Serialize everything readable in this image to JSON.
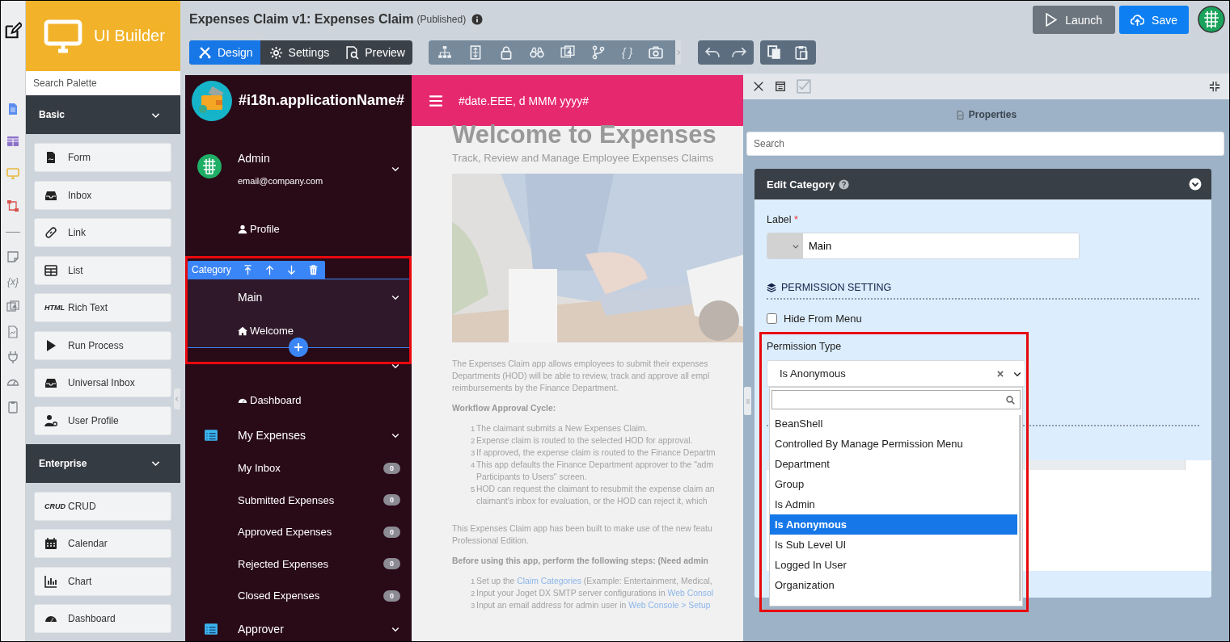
{
  "rail": {
    "glyph": "{x}"
  },
  "palette": {
    "title": "UI Builder",
    "search": {
      "placeholder": "Search Palette"
    },
    "sections": [
      {
        "title": "Basic",
        "items": [
          {
            "label": "Form"
          },
          {
            "label": "Inbox"
          },
          {
            "label": "Link"
          },
          {
            "label": "List"
          },
          {
            "label": "Rich Text",
            "glyph": "HTML"
          },
          {
            "label": "Run Process"
          },
          {
            "label": "Universal Inbox"
          },
          {
            "label": "User Profile"
          }
        ]
      },
      {
        "title": "Enterprise",
        "items": [
          {
            "label": "CRUD",
            "glyph": "CRUD"
          },
          {
            "label": "Calendar"
          },
          {
            "label": "Chart"
          },
          {
            "label": "Dashboard"
          }
        ]
      }
    ]
  },
  "header": {
    "title": "Expenses Claim v1: Expenses Claim",
    "status": "(Published)",
    "tabs": [
      {
        "label": "Design",
        "selected": true
      },
      {
        "label": "Settings",
        "selected": false
      },
      {
        "label": "Preview",
        "selected": false
      }
    ],
    "code_glyph": "{ }",
    "buttons": [
      {
        "label": "Launch",
        "kind": "secondary"
      },
      {
        "label": "Save",
        "kind": "primary"
      }
    ]
  },
  "app": {
    "name": "#i18n.applicationName#",
    "date": "#date.EEE, d MMM yyyy#",
    "user": {
      "name": "Admin",
      "email": "email@company.com"
    },
    "selection_label": "Category",
    "menu": [
      {
        "kind": "link",
        "label": "Profile"
      },
      {
        "kind": "category",
        "label": "Main",
        "selected": true,
        "children": [
          {
            "kind": "link",
            "label": "Welcome"
          }
        ]
      },
      {
        "kind": "category",
        "selected": false,
        "children": [
          {
            "kind": "link",
            "label": "Dashboard"
          }
        ]
      },
      {
        "kind": "category",
        "label": "My Expenses",
        "selected": false,
        "children": [
          {
            "kind": "inbox",
            "label": "My Inbox",
            "count": "0"
          },
          {
            "kind": "inbox",
            "label": "Submitted Expenses",
            "count": "0"
          },
          {
            "kind": "inbox",
            "label": "Approved Expenses",
            "count": "0"
          },
          {
            "kind": "inbox",
            "label": "Rejected Expenses",
            "count": "0"
          },
          {
            "kind": "inbox",
            "label": "Closed Expenses",
            "count": "0"
          }
        ]
      },
      {
        "kind": "category",
        "label": "Approver",
        "selected": false
      }
    ]
  },
  "content": {
    "title": "Welcome to Expenses",
    "subtitle": "Track, Review and Manage Employee Expenses Claims",
    "blocks": [
      {
        "kind": "paragraph",
        "lines": [
          "The Expenses Claim app allows employees to submit their expenses",
          "Departments (HOD) will be able to review, track and approve all empl",
          "reimbursements by the Finance Department."
        ]
      },
      {
        "kind": "heading",
        "text": "Workflow Approval Cycle:"
      },
      {
        "kind": "list",
        "items": [
          {
            "number": "1",
            "lines": [
              [
                {
                  "text": "The claimant submits a New Expenses Claim."
                }
              ]
            ]
          },
          {
            "number": "2",
            "lines": [
              [
                {
                  "text": "Expense claim is routed to the selected HOD for approval."
                }
              ]
            ]
          },
          {
            "number": "3",
            "lines": [
              [
                {
                  "text": "If approved, the expense claim is routed to the Finance Departm"
                }
              ]
            ]
          },
          {
            "number": "4",
            "lines": [
              [
                {
                  "text": "This app defaults the Finance Department approver to the \"adm"
                }
              ],
              [
                {
                  "text": "Participants to Users\" screen."
                }
              ]
            ]
          },
          {
            "number": "5",
            "lines": [
              [
                {
                  "text": "HOD can request the claimant to resubmit the expense claim an"
                }
              ],
              [
                {
                  "text": "claimant's inbox for evaluation, or the HOD can reject it, which"
                }
              ]
            ]
          }
        ]
      },
      {
        "kind": "paragraph",
        "lines": [
          "This Expenses Claim app has been built to make use of the new featu",
          "Professional Edition."
        ]
      },
      {
        "kind": "heading",
        "text": "Before using this app, perform the following steps: (Need admin"
      },
      {
        "kind": "list",
        "items": [
          {
            "number": "1",
            "lines": [
              [
                {
                  "text": "Set up the "
                },
                {
                  "text": "Claim Categories",
                  "link": true
                },
                {
                  "text": " (Example: Entertainment, Medical,"
                }
              ]
            ]
          },
          {
            "number": "2",
            "lines": [
              [
                {
                  "text": "Input your Joget DX SMTP server configurations in "
                },
                {
                  "text": "Web Consol",
                  "link": true
                }
              ]
            ]
          },
          {
            "number": "3",
            "lines": [
              [
                {
                  "text": "Input an email address for admin user in "
                },
                {
                  "text": "Web Console > Setup",
                  "link": true
                }
              ]
            ]
          }
        ]
      }
    ]
  },
  "properties": {
    "title": "Properties",
    "search": {
      "placeholder": "Search"
    },
    "card": {
      "title": "Edit Category",
      "expanded": true,
      "label_field": {
        "label": "Label",
        "required_mark": "*",
        "value": "Main"
      },
      "section": "PERMISSION SETTING",
      "hide_from_menu": {
        "label": "Hide From Menu",
        "checked": false
      },
      "permission": {
        "label": "Permission Type",
        "value": "Is Anonymous",
        "expanded": true,
        "options": [
          {
            "label": "BeanShell",
            "selected": false
          },
          {
            "label": "Controlled By Manage Permission Menu",
            "selected": false
          },
          {
            "label": "Department",
            "selected": false
          },
          {
            "label": "Group",
            "selected": false
          },
          {
            "label": "Is Admin",
            "selected": false
          },
          {
            "label": "Is Anonymous",
            "selected": true
          },
          {
            "label": "Is Sub Level UI",
            "selected": false
          },
          {
            "label": "Logged In User",
            "selected": false
          },
          {
            "label": "Organization",
            "selected": false
          }
        ]
      }
    }
  }
}
